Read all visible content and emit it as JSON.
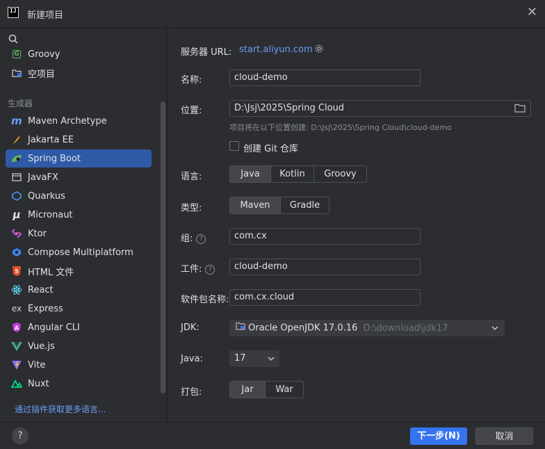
{
  "window": {
    "title": "新建项目"
  },
  "sidebar": {
    "top_items": [
      {
        "label": "Groovy",
        "icon": "groovy-icon"
      },
      {
        "label": "空项目",
        "icon": "empty-project-icon"
      }
    ],
    "section_label": "生成器",
    "generators": [
      {
        "label": "Maven Archetype",
        "icon": "maven-icon"
      },
      {
        "label": "Jakarta EE",
        "icon": "jakarta-icon"
      },
      {
        "label": "Spring Boot",
        "icon": "spring-boot-icon",
        "selected": true
      },
      {
        "label": "JavaFX",
        "icon": "javafx-icon"
      },
      {
        "label": "Quarkus",
        "icon": "quarkus-icon"
      },
      {
        "label": "Micronaut",
        "icon": "micronaut-icon"
      },
      {
        "label": "Ktor",
        "icon": "ktor-icon"
      },
      {
        "label": "Compose Multiplatform",
        "icon": "compose-icon"
      },
      {
        "label": "HTML 文件",
        "icon": "html-icon"
      },
      {
        "label": "React",
        "icon": "react-icon"
      },
      {
        "label": "Express",
        "icon": "express-icon"
      },
      {
        "label": "Angular CLI",
        "icon": "angular-icon"
      },
      {
        "label": "Vue.js",
        "icon": "vue-icon"
      },
      {
        "label": "Vite",
        "icon": "vite-icon"
      },
      {
        "label": "Nuxt",
        "icon": "nuxt-icon"
      }
    ],
    "more_link": "通过插件获取更多语言..."
  },
  "form": {
    "server_url_label": "服务器 URL:",
    "server_url": "start.aliyun.com",
    "name_label": "名称:",
    "name_value": "cloud-demo",
    "location_label": "位置:",
    "location_value": "D:\\Jsj\\2025\\Spring Cloud",
    "location_hint": "项目将在以下位置创建: D:\\Jsj\\2025\\Spring Cloud\\cloud-demo",
    "git_label": "创建 Git 仓库",
    "language_label": "语言:",
    "languages": [
      "Java",
      "Kotlin",
      "Groovy"
    ],
    "type_label": "类型:",
    "types": [
      "Maven",
      "Gradle"
    ],
    "group_label": "组:",
    "group_value": "com.cx",
    "artifact_label": "工件:",
    "artifact_value": "cloud-demo",
    "package_label": "软件包名称:",
    "package_value": "com.cx.cloud",
    "jdk_label": "JDK:",
    "jdk_name": "Oracle OpenJDK 17.0.16",
    "jdk_path": "D:\\download\\jdk17",
    "java_label": "Java:",
    "java_value": "17",
    "packaging_label": "打包:",
    "packagings": [
      "Jar",
      "War"
    ]
  },
  "footer": {
    "help": "?",
    "next_label": "下一步(N)",
    "cancel_label": "取消"
  },
  "colors": {
    "accent": "#3574f0",
    "link": "#6c9ef8",
    "background": "#2b2d30"
  }
}
